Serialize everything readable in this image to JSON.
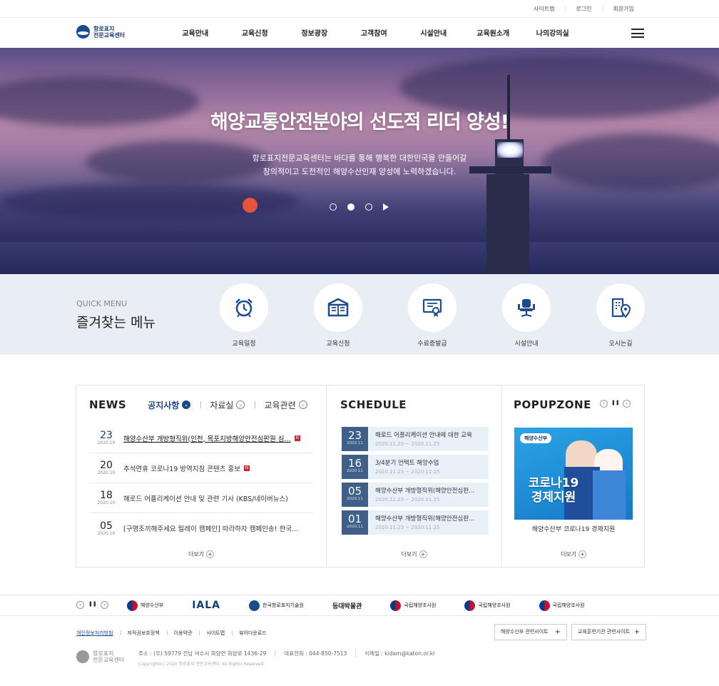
{
  "util": {
    "sitemap": "사이트맵",
    "login": "로그인",
    "join": "회원가입"
  },
  "logo": {
    "line1": "항로표지",
    "line2": "전문교육센터"
  },
  "gnb": [
    "교육안내",
    "교육신청",
    "정보광장",
    "고객참여",
    "시설안내",
    "교육원소개",
    "나의강의실"
  ],
  "hero": {
    "title": "해양교통안전분야의 선도적 리더 양성!",
    "sub1": "항로표지전문교육센터는 바다를 통해 행복한 대한민국을 만들어갈",
    "sub2": "창의적이고 도전적인 해양수산인재 양성에 노력하겠습니다."
  },
  "quick": {
    "en": "QUICK MENU",
    "ko": "즐겨찾는 메뉴",
    "items": [
      {
        "label": "교육일정",
        "icon": "alarm-clock-icon"
      },
      {
        "label": "교육신청",
        "icon": "book-icon"
      },
      {
        "label": "수료증발급",
        "icon": "certificate-icon"
      },
      {
        "label": "시설안내",
        "icon": "chair-icon"
      },
      {
        "label": "오시는길",
        "icon": "map-location-icon"
      }
    ]
  },
  "news": {
    "title": "NEWS",
    "tabs": [
      "공지사항",
      "자료실",
      "교육관련"
    ],
    "items": [
      {
        "day": "23",
        "ym": "2020.10",
        "title": "해양수산부 개방형직위(인천, 목포지방해양안전심판원 심...",
        "new": "N"
      },
      {
        "day": "20",
        "ym": "2020.10",
        "title": "추석연휴 코로나19 방역지침 콘텐츠 홍보",
        "new": "N"
      },
      {
        "day": "18",
        "ym": "2020.10",
        "title": "해로드 어플리케이션 안내 및 관련 기사 (KBS/네이버뉴스)",
        "new": ""
      },
      {
        "day": "05",
        "ym": "2020.10",
        "title": "[구명조끼해주세요 릴레이 캠페인] 따라하자 캠페인송! 한국...",
        "new": ""
      }
    ],
    "more": "더보기"
  },
  "schedule": {
    "title": "SCHEDULE",
    "items": [
      {
        "day": "23",
        "ym": "2020.11",
        "title": "해로드 어플리케이션 안내에 대한 교육",
        "period": "2020.11.23 ~ 2020.11.25"
      },
      {
        "day": "16",
        "ym": "2020.11",
        "title": "3/4분기 언택트 해양수업",
        "period": "2020.11.23 ~ 2020.11.25"
      },
      {
        "day": "05",
        "ym": "2020.11",
        "title": "해양수산부 개방형직위(해양안전심판...",
        "period": "2020.11.23 ~ 2020.11.25"
      },
      {
        "day": "01",
        "ym": "2020.11",
        "title": "해양수산부 개방형직위(해양안전심판...",
        "period": "2020.11.23 ~ 2020.11.25"
      }
    ],
    "more": "더보기"
  },
  "popup": {
    "title": "POPUPZONE",
    "org": "해양수산부",
    "big1": "코로나19",
    "big2": "경제지원",
    "caption": "해양수산부 코로나19 경제지원",
    "more": "더보기"
  },
  "family": [
    {
      "name": "해양수산부",
      "type": "emblem"
    },
    {
      "name": "IALA",
      "type": "iala"
    },
    {
      "name": "한국항로표지기술원",
      "type": "kriso"
    },
    {
      "name": "등대박물관",
      "type": "museum"
    },
    {
      "name": "국립해양조사원",
      "type": "emblem"
    },
    {
      "name": "국립해양조사원",
      "type": "emblem"
    },
    {
      "name": "국립해양조사원",
      "type": "emblem"
    }
  ],
  "footer": {
    "links": [
      "개인정보처리방침",
      "저작권보호정책",
      "이용약관",
      "사이트맵",
      "뷰어다운로드"
    ],
    "sites": [
      "해양수산부 관련사이트",
      "교육훈련기관 관련사이트"
    ],
    "logo1": "항로표지",
    "logo2": "전문교육센터",
    "addr": "주소 : (우) 59779 전남 여수시 화양면 화양로 1436-29",
    "tel": "대표전화 : 044-850-7513",
    "email": "이메일 : kidam@katon.or.kr",
    "copy": "Copyright(c) 2020 항로표지 전문교육센터. All Rights Reserved."
  },
  "colors": {
    "primary": "#1d4b8f",
    "quickbg": "#e9edf4",
    "badge": "#d0222a",
    "schedule_date": "#3d5f8a"
  }
}
